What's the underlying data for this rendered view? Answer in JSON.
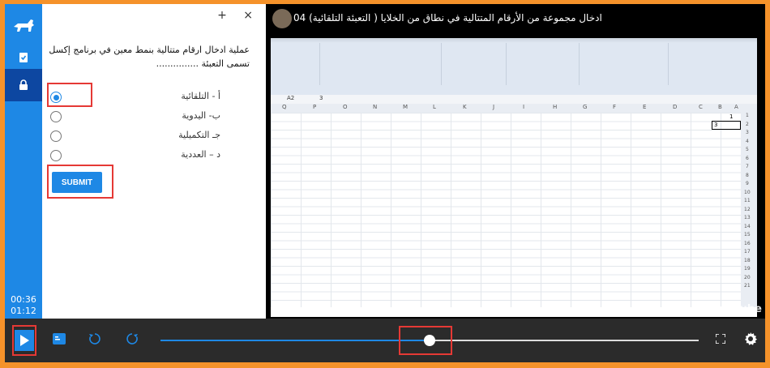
{
  "rail": {
    "time_elapsed": "00:36",
    "time_total": "01:12"
  },
  "quiz": {
    "header_add": "+",
    "header_close": "×",
    "question": "عملية ادخال ارقام متتالية بنمط معين في برنامج إكسل تسمى التعبئة ...............",
    "options": [
      {
        "label": "أ - التلقائية",
        "selected": true
      },
      {
        "label": "ب- اليدوية",
        "selected": false
      },
      {
        "label": "جـ التكميلية",
        "selected": false
      },
      {
        "label": "د – العددية",
        "selected": false
      }
    ],
    "submit_label": "SUBMIT"
  },
  "video": {
    "title": "ادخال مجموعة من الأرقام المتتالية في نطاق من الخلايا ( التعبئة التلقائية) 04",
    "watermark": "YouTube",
    "excel": {
      "name_box": "A2",
      "formula_value": "3",
      "columns": [
        "Q",
        "P",
        "O",
        "N",
        "M",
        "L",
        "K",
        "J",
        "I",
        "H",
        "G",
        "F",
        "E",
        "D",
        "C",
        "B",
        "A"
      ],
      "rows": [
        "1",
        "2",
        "3",
        "4",
        "5",
        "6",
        "7",
        "8",
        "9",
        "10",
        "11",
        "12",
        "13",
        "14",
        "15",
        "16",
        "17",
        "18",
        "19",
        "20",
        "21"
      ],
      "cell_a1": "1",
      "cell_a2": "3"
    }
  },
  "player": {
    "progress": 0.5,
    "accent": "#1e88e5"
  }
}
